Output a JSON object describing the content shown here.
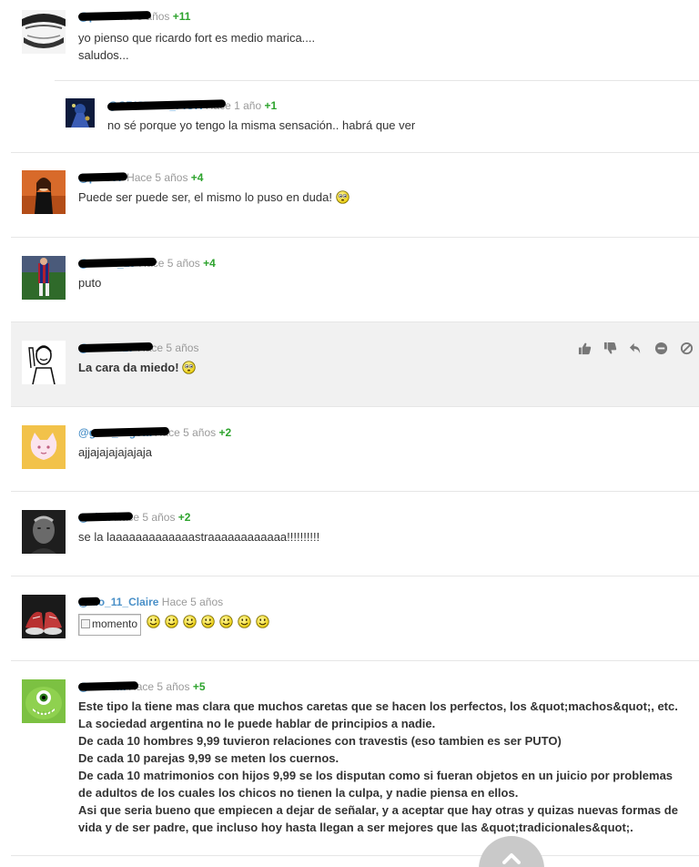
{
  "comments": [
    {
      "user": "@pat",
      "time": "Hace 5 años",
      "score": "+11",
      "text": [
        "yo pienso que ricardo fort es medio marica....",
        "saludos..."
      ]
    },
    {
      "user": "@CRISTIAN_PIOR",
      "time": "Hace 1 año",
      "score": "+1",
      "text": [
        "no sé porque yo tengo la misma sensación.. habrá que ver"
      ]
    },
    {
      "user": "@pelo07",
      "time": "Hace 5 años",
      "score": "+4",
      "text": [
        "Puede ser puede ser, el mismo lo puso en duda!"
      ]
    },
    {
      "user": "@zazza_19",
      "time": "Hace 5 años",
      "score": "+4",
      "text": [
        "puto"
      ]
    },
    {
      "user": "@mortal27",
      "time": "Hace 5 años",
      "score": "",
      "text": [
        "La cara da miedo!"
      ]
    },
    {
      "user": "@gato_rogeta",
      "time": "Hace 5 años",
      "score": "+2",
      "text": [
        "ajjajajajajajaja"
      ]
    },
    {
      "user": "@clan",
      "time": "Hace 5 años",
      "score": "+2",
      "text": [
        "se la laaaaaaaaaaaaastraaaaaaaaaaaa!!!!!!!!!!"
      ]
    },
    {
      "user": "@alo_11_Claire",
      "time": "Hace 5 años",
      "score": "",
      "broken_img_alt": "momento",
      "text": []
    },
    {
      "user": "@Verona",
      "time": "Hace 5 años",
      "score": "+5",
      "text": [
        "Este tipo la tiene mas clara que muchos caretas que se hacen los perfectos, los &quot;machos&quot;, etc.",
        "La sociedad argentina no le puede hablar de principios a nadie.",
        "De cada 10 hombres 9,99 tuvieron relaciones con travestis (eso tambien es ser PUTO)",
        "De cada 10 parejas 9,99 se meten los cuernos.",
        "De cada 10 matrimonios con hijos 9,99 se los disputan como si fueran objetos en un juicio por problemas",
        "de adultos de los cuales los chicos no tienen la culpa, y nadie piensa en ellos.",
        "Asi que seria bueno que empiecen a dejar de señalar, y a aceptar que hay otras y quizas nuevas formas de",
        "vida y de ser padre, que incluso hoy hasta llegan a ser mejores que las &quot;tradicionales&quot;."
      ]
    }
  ],
  "icons": {
    "smiley": "confused-smiley-icon",
    "happy": "happy-smiley-icon",
    "actions": [
      "thumbs-up-icon",
      "thumbs-down-icon",
      "reply-icon",
      "minus-circle-icon",
      "block-icon"
    ],
    "scroll": "chevron-up-icon"
  },
  "colors": {
    "username": "#4a90c8",
    "score": "#2da32d",
    "time": "#9a9a9a",
    "highlight_bg": "#f1f1f1"
  }
}
